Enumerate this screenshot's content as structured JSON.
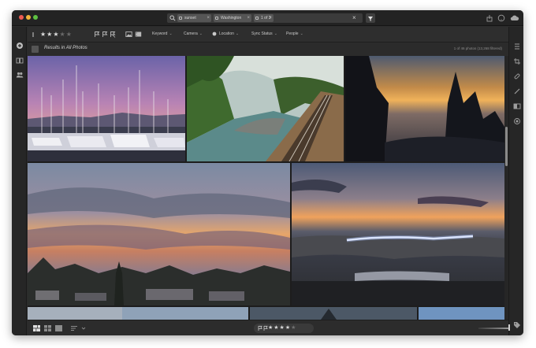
{
  "titlebar": {
    "search_chips": [
      {
        "label": "sunset"
      },
      {
        "label": "Washington"
      },
      {
        "label": "1 of 3"
      }
    ],
    "clear_label": "×"
  },
  "filterbar": {
    "rating_filled": "★★★",
    "rating_empty": "★★",
    "keyword_label": "Keyword",
    "camera_label": "Camera",
    "location_label": "Location",
    "sync_status_label": "Sync Status",
    "people_label": "People",
    "chevron": "⌄"
  },
  "results": {
    "title": "Results in All Photos",
    "count": "1 of 46 photos (13,268 filtered)"
  },
  "bottombar": {
    "rating_filled": "★★★★",
    "rating_empty": "★"
  },
  "icons": {
    "left_sidebar": [
      "add-photos-icon",
      "library-icon",
      "people-icon"
    ],
    "right_sidebar": [
      "edit-icon",
      "crop-icon",
      "healing-icon",
      "brush-icon",
      "gradient-icon",
      "radial-icon",
      "tag-icon",
      "info-icon"
    ]
  },
  "colors": {
    "window_bg": "#2b2b2b",
    "titlebar_bg": "#232323",
    "close": "#ee5b52",
    "minimize": "#f3b43b",
    "maximize": "#5ec142"
  }
}
